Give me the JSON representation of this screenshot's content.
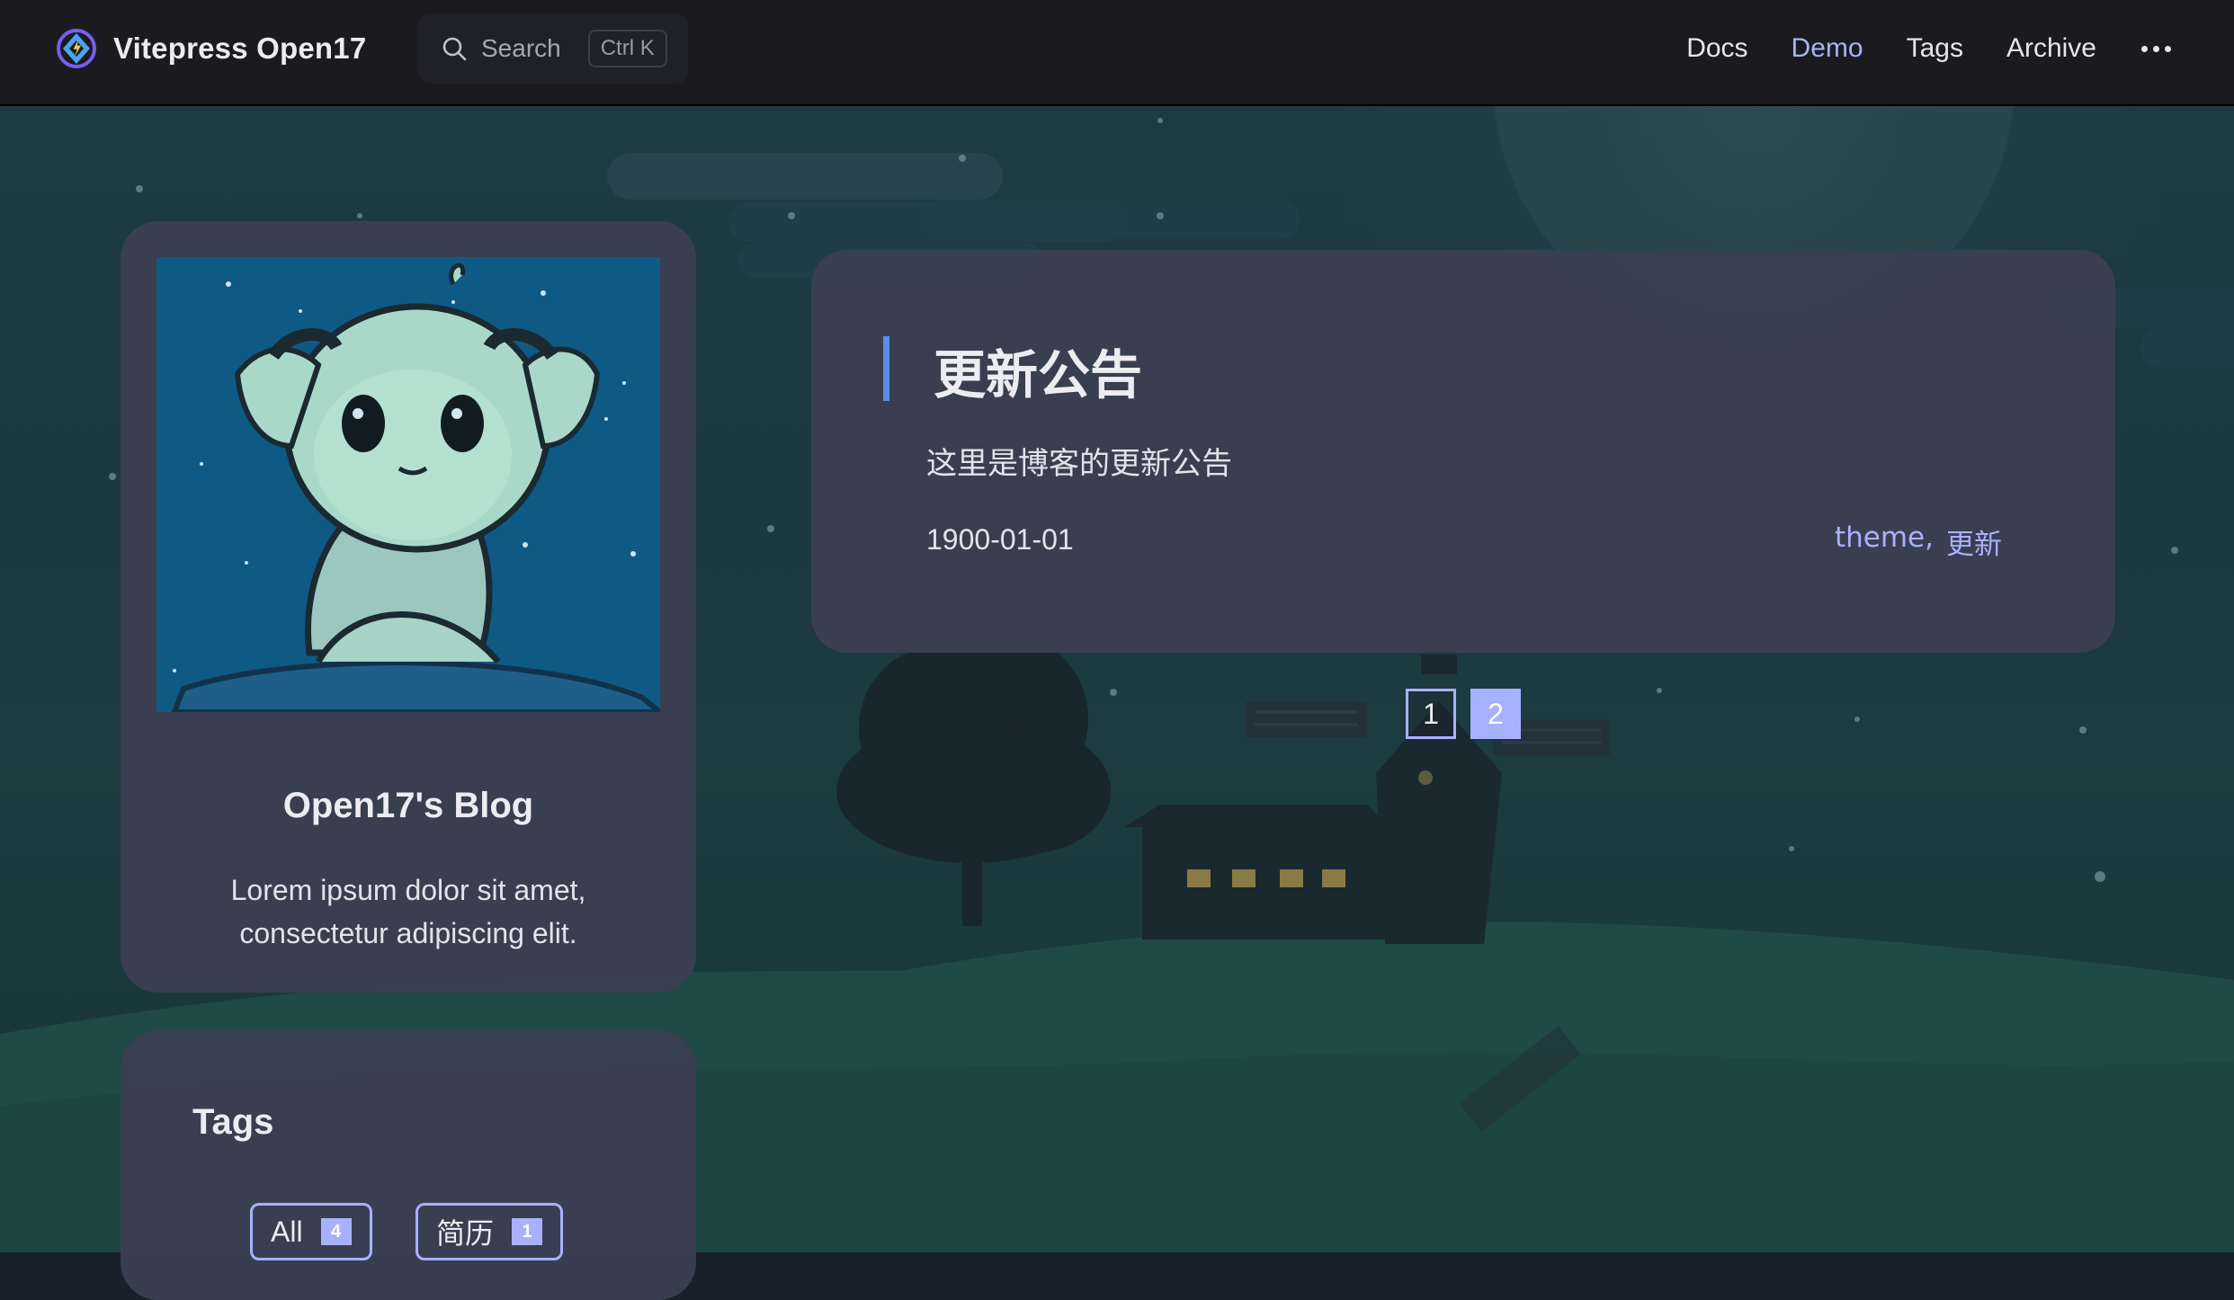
{
  "navbar": {
    "brand_title": "Vitepress Open17",
    "search": {
      "label": "Search",
      "shortcut": "Ctrl K"
    },
    "links": [
      {
        "label": "Docs",
        "active": false
      },
      {
        "label": "Demo",
        "active": true
      },
      {
        "label": "Tags",
        "active": false
      },
      {
        "label": "Archive",
        "active": false
      }
    ],
    "more_icon": "ellipsis-icon"
  },
  "profile": {
    "name": "Open17's Blog",
    "description": "Lorem ipsum dolor sit amet, consectetur adipiscing elit."
  },
  "tags_card": {
    "title": "Tags",
    "tags": [
      {
        "label": "All",
        "count": "4"
      },
      {
        "label": "简历",
        "count": "1"
      }
    ]
  },
  "post": {
    "title": "更新公告",
    "excerpt": "这里是博客的更新公告",
    "date": "1900-01-01",
    "tags": [
      "theme",
      "更新"
    ],
    "tag_separator": ","
  },
  "pagination": {
    "pages": [
      "1",
      "2"
    ],
    "current": "1"
  },
  "colors": {
    "accent": "#a8b1ff",
    "title_bar": "#5a8ee6",
    "navbar_bg": "#1b1b1f",
    "card_bg": "#3a4052"
  }
}
